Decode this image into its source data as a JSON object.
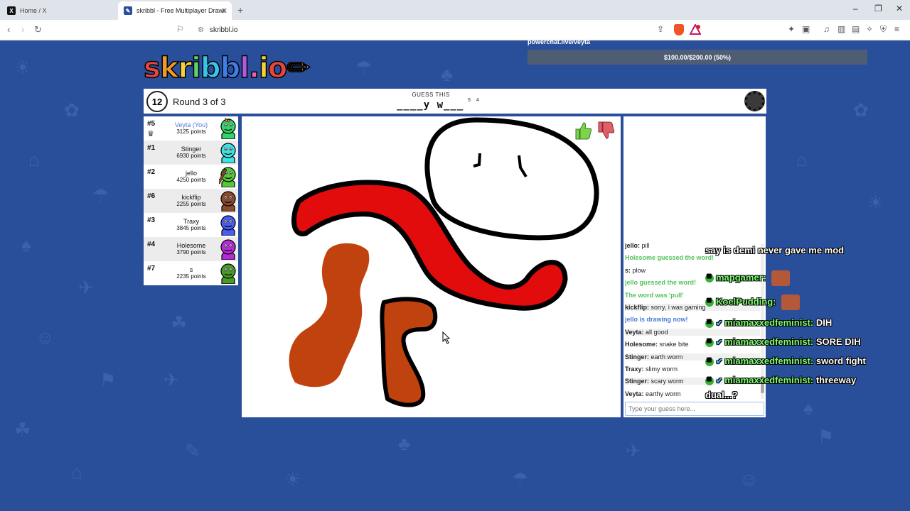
{
  "browser": {
    "tabs": [
      {
        "title": "Home / X",
        "icon": "x-logo-icon"
      },
      {
        "title": "skribbl - Free Multiplayer Drawi",
        "icon": "skribbl-icon",
        "active": true
      }
    ],
    "url": "skribbl.io"
  },
  "stream": {
    "donation_label": "powerchat.live/veyta",
    "donation_progress_text": "$100.00/$200.00 (50%)",
    "donation_progress": 0.5
  },
  "game": {
    "logo": "skribbl.io",
    "timer": "12",
    "round": "Round 3 of 3",
    "guess_label": "GUESS THIS",
    "word_hint": "____y w___",
    "word_lengths": "5 4"
  },
  "players": [
    {
      "rank": "#5",
      "name": "Veyta (You)",
      "points": "3125 points",
      "me": true,
      "avatar_color": "#33d46a",
      "crown": true,
      "hand": true
    },
    {
      "rank": "#1",
      "name": "Stinger",
      "points": "6930 points",
      "avatar_color": "#3fe0e0"
    },
    {
      "rank": "#2",
      "name": "jello",
      "points": "4250 points",
      "avatar_color": "#55c83a",
      "pencil": true
    },
    {
      "rank": "#6",
      "name": "kickflip",
      "points": "2255 points",
      "avatar_color": "#8b4a2b"
    },
    {
      "rank": "#3",
      "name": "Traxy",
      "points": "3845 points",
      "avatar_color": "#4a5cf0"
    },
    {
      "rank": "#4",
      "name": "Holesome",
      "points": "3790 points",
      "avatar_color": "#b52ad6"
    },
    {
      "rank": "#7",
      "name": "s",
      "points": "2235 points",
      "avatar_color": "#4a9a2a"
    }
  ],
  "chat": {
    "messages": [
      {
        "author": "jello",
        "text": "pill"
      },
      {
        "system": "Holesome guessed the word!",
        "style": "green"
      },
      {
        "author": "s",
        "text": "plow"
      },
      {
        "system": "jello guessed the word!",
        "style": "green"
      },
      {
        "system": "The word was 'pull'",
        "style": "green"
      },
      {
        "author": "kickflip",
        "text": "sorry, i was gaming"
      },
      {
        "system": "jello is drawing now!",
        "style": "blue"
      },
      {
        "author": "Veyta",
        "text": "all good"
      },
      {
        "author": "Holesome",
        "text": "snake bite"
      },
      {
        "author": "Stinger",
        "text": "earth worm"
      },
      {
        "author": "Traxy",
        "text": "slimy worm"
      },
      {
        "author": "Stinger",
        "text": "scary worm"
      },
      {
        "author": "Veyta",
        "text": "earthy worm"
      }
    ],
    "input_placeholder": "Type your guess here..."
  },
  "overlay_chat": [
    {
      "text": "say is demi never gave me mod"
    },
    {
      "name": "mapgamer:",
      "text": "",
      "has_pic": true
    },
    {
      "name": "KoelPudding:",
      "text": "",
      "has_pic": true
    },
    {
      "name": "miamaxxedfeminist:",
      "text": "DIH",
      "verified": true
    },
    {
      "name": "miamaxxedfeminist:",
      "text": "SORE DIH",
      "verified": true
    },
    {
      "name": "miamaxxedfeminist:",
      "text": "sword fight",
      "verified": true
    },
    {
      "name": "miamaxxedfeminist:",
      "text": "threeway",
      "verified": true
    },
    {
      "text": "dual...?"
    }
  ]
}
